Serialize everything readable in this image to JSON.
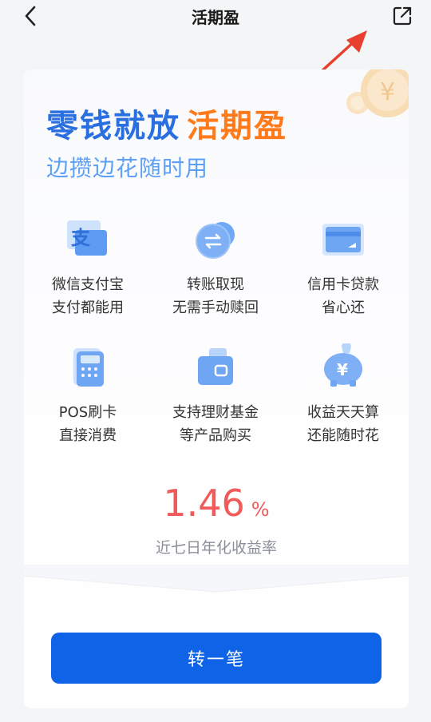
{
  "nav": {
    "title": "活期盈",
    "back_icon": "chevron-left-icon",
    "share_icon": "share-external-icon"
  },
  "hero": {
    "headline_part1": "零钱就放",
    "headline_part2": "活期盈",
    "subline": "边攒边花随时用"
  },
  "features": [
    {
      "icon": "alipay-icon",
      "line1": "微信支付宝",
      "line2": "支付都能用"
    },
    {
      "icon": "transfer-icon",
      "line1": "转账取现",
      "line2": "无需手动赎回"
    },
    {
      "icon": "credit-card-icon",
      "line1": "信用卡贷款",
      "line2": "省心还"
    },
    {
      "icon": "pos-terminal-icon",
      "line1": "POS刷卡",
      "line2": "直接消费"
    },
    {
      "icon": "wallet-icon",
      "line1": "支持理财基金",
      "line2": "等产品购买"
    },
    {
      "icon": "piggy-bank-icon",
      "line1": "收益天天算",
      "line2": "还能随时花"
    }
  ],
  "rate": {
    "value": "1.46",
    "unit": "%",
    "label": "近七日年化收益率"
  },
  "cta": {
    "label": "转一笔"
  },
  "colors": {
    "brand_blue": "#0f63e6",
    "headline_blue": "#2a6fe0",
    "headline_orange": "#ff7a1a",
    "rate_red": "#f05a5a",
    "annotation_arrow": "#e8402f"
  }
}
